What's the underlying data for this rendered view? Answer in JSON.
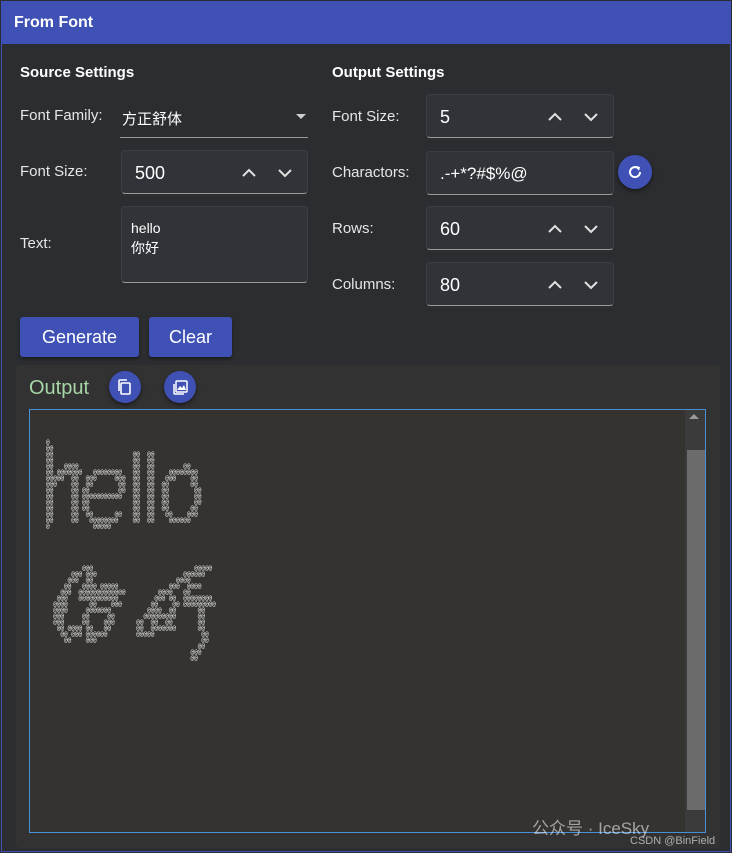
{
  "window": {
    "title": "From Font"
  },
  "source": {
    "heading": "Source Settings",
    "font_family_label": "Font Family:",
    "font_family_value": "方正舒体",
    "font_size_label": "Font Size:",
    "font_size_value": "500",
    "text_label": "Text:",
    "text_line1": "hello",
    "text_line2": "你好"
  },
  "output_settings": {
    "heading": "Output Settings",
    "font_size_label": "Font Size:",
    "font_size_value": "5",
    "chars_label": "Charactors:",
    "chars_value": ".-+*?#$%@",
    "rows_label": "Rows:",
    "rows_value": "60",
    "columns_label": "Columns:",
    "columns_value": "80"
  },
  "actions": {
    "generate": "Generate",
    "clear": "Clear"
  },
  "output": {
    "title": "Output",
    "ascii": "@\n@@\n@@                      @@  @@\n@@                      @@  @@\n@@   @@@@               @@  @@        @@\n@@ @@@@@@@   @@@@@@@@   @@  @@    @@@@@@@@\n@@@@@  @@  @@@     @@@  @@  @@   @@@    @@\n@@@    @@  @@       @@  @@  @@  @@      @@\n@@     @@ @@        @@  @@  @@  @@       @@\n@@     @@ @@@@@@@@@@@   @@  @@  @@       @@\n@@     @@ @@            @@  @@  @@       @@\n@@     @@ @@            @@  @@  @@      @@\n@@     @@  @@      @@   @@  @@   @@    @@@\n@@     @@   @@@@@@@@    @@  @@    @@@@@@\n@            @@@@@\n\n\n\n\n\n\n          @@@                            @@@@@\n       @@@ @@@                        @@@@@@\n      @@@  @@                       @@@@\n     @@   @@@@ @@@@@              @@@  @@@@\n    @@@  @@@@@@@@@@@@@         @@@@   @@\n   @@@   @@@@@@@@@@@          @@@ @@  @@@@@@@@\n  @@@@      @@    @@@        @@    @@ @@@@@@@@@\n  @@@@     @@@@@@@          @@@@  @@      @@\n  @@@     @@     @@        @@@@@@@@@      @@\n  @@@     @@    @@@      @@  @@  @@       @@\n   @@ @@@@ @@   @@       @@  @@@@@@@      @@\n    @@ @@@ @@@@@@        @@@@@             @@\n     @@    @@@                             @@\n                                          @@\n                                        @@@\n                                        @@"
  },
  "watermark": {
    "main": "公众号 · IceSky",
    "sub": "CSDN @BinField"
  },
  "colors": {
    "accent": "#3f51b5",
    "output_title": "#a5d6a7",
    "border": "#4a90d9"
  },
  "icons": {
    "refresh": "refresh-icon",
    "copy": "copy-icon",
    "image": "image-icon",
    "up": "chevron-up-icon",
    "down": "chevron-down-icon"
  }
}
